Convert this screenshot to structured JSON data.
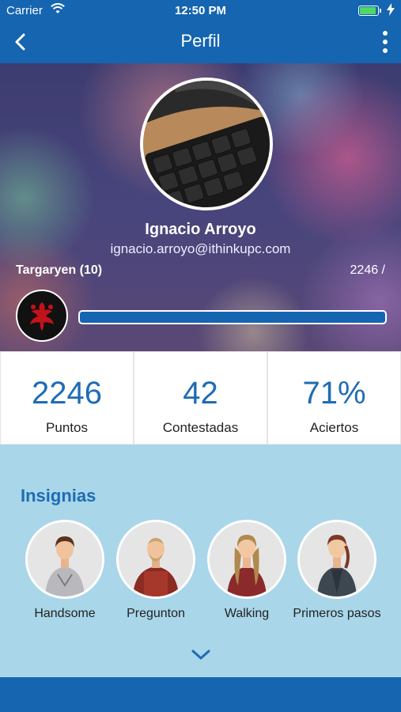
{
  "status_bar": {
    "carrier": "Carrier",
    "time": "12:50 PM"
  },
  "nav": {
    "title": "Perfil",
    "icons": [
      "back-chevron-icon",
      "more-vertical-icon"
    ]
  },
  "profile": {
    "name": "Ignacio Arroyo",
    "email": "ignacio.arroyo@ithinkupc.com",
    "house": "Targaryen (10)",
    "points_label": "2246 /",
    "progress_fraction": 1.0
  },
  "stats": [
    {
      "value": "2246",
      "label": "Puntos"
    },
    {
      "value": "42",
      "label": "Contestadas"
    },
    {
      "value": "71%",
      "label": "Aciertos"
    }
  ],
  "badges": {
    "heading": "Insignias",
    "items": [
      {
        "label": "Handsome"
      },
      {
        "label": "Pregunton"
      },
      {
        "label": "Walking"
      },
      {
        "label": "Primeros pasos"
      }
    ]
  },
  "colors": {
    "primary": "#1565b0",
    "accent_text": "#1e6cb4",
    "badges_bg": "#a9d6e9",
    "battery": "#4cd964"
  }
}
